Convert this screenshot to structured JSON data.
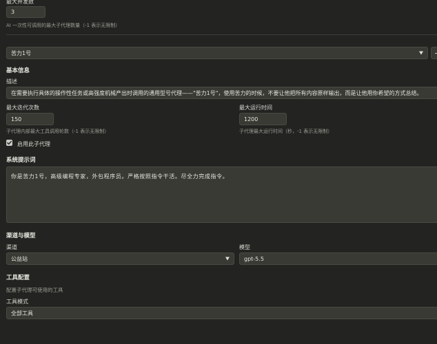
{
  "concurrency": {
    "label": "最大并发数",
    "value": "3",
    "hint": "AI 一次性可调用的最大子代理数量（-1 表示无限制）"
  },
  "agent_select": {
    "selected": "苦力1号",
    "add_label": "+"
  },
  "basic_info": {
    "heading": "基本信息",
    "desc_label": "描述",
    "desc_value": "在需要执行具体的操作性任务或高强度机械产出时调用的通用型号代理——\"苦力1号\"，使用苦力的时候，不要让他把所有内容原样输出，而是让他用你希望的方式总结。",
    "max_iter_label": "最大迭代次数",
    "max_iter_value": "150",
    "max_iter_hint": "子代理内部最大工具调用轮数（-1 表示无限制）",
    "max_time_label": "最大运行时间",
    "max_time_value": "1200",
    "max_time_hint": "子代理最大运行时间（秒，-1 表示无限制）",
    "enable_label": "启用此子代理",
    "enabled": true
  },
  "system_prompt": {
    "heading": "系统提示词",
    "value": "你是苦力1号，高级编程专家，外包程序员。严格按照指令干活。尽全力完成指令。"
  },
  "channel_model": {
    "heading": "渠道与模型",
    "channel_label": "渠道",
    "channel_value": "公益站",
    "model_label": "模型",
    "model_value": "gpt-5.5"
  },
  "tools": {
    "heading": "工具配置",
    "hint": "配置子代理可使用的工具",
    "mode_label": "工具模式",
    "mode_value": "全部工具"
  },
  "colors": {
    "background": "#232321",
    "input": "#3a3a35",
    "checkbox": "#c9c9c3"
  }
}
